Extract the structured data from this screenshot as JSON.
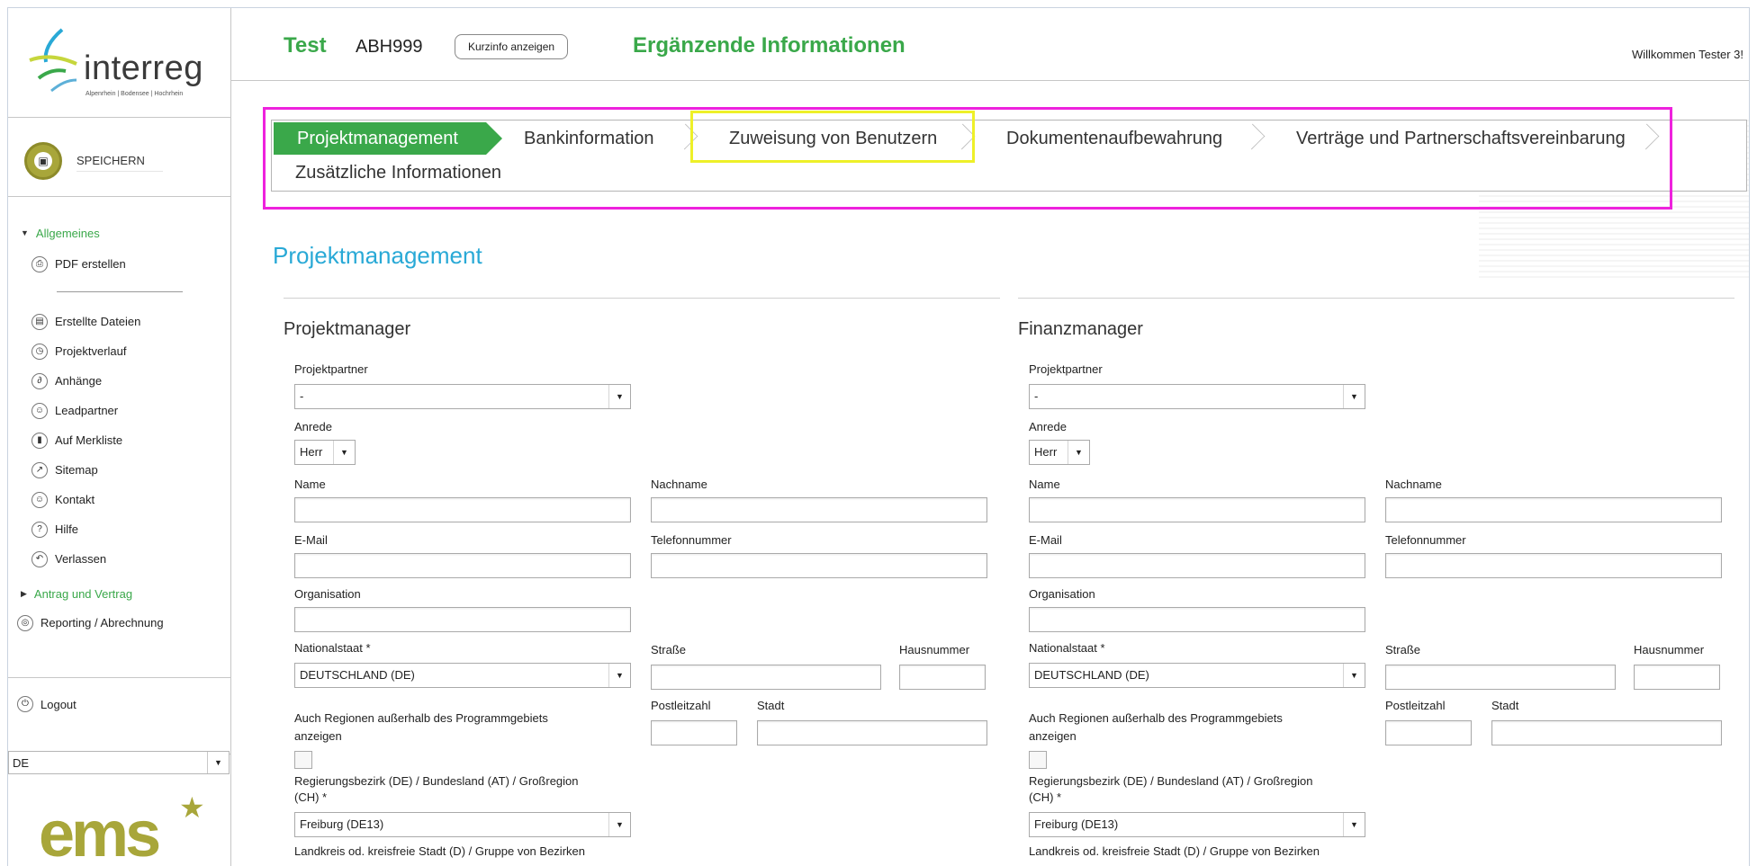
{
  "brand": {
    "logo_word": "interreg",
    "logo_subtitle": "Alpenrhein | Bodensee | Hochrhein",
    "footer_logo": "ems"
  },
  "sidebar": {
    "save_label": "SPEICHERN",
    "sections": [
      {
        "label": "Allgemeines",
        "expanded": true
      },
      {
        "label": "Antrag und Vertrag",
        "expanded": false
      }
    ],
    "items_top": [
      {
        "label": "PDF erstellen",
        "icon": "print-icon"
      }
    ],
    "items": [
      {
        "label": "Erstellte Dateien",
        "icon": "file-icon"
      },
      {
        "label": "Projektverlauf",
        "icon": "history-icon"
      },
      {
        "label": "Anhänge",
        "icon": "paperclip-icon"
      },
      {
        "label": "Leadpartner",
        "icon": "user-icon"
      },
      {
        "label": "Auf Merkliste",
        "icon": "bookmark-icon"
      },
      {
        "label": "Sitemap",
        "icon": "external-link-icon"
      },
      {
        "label": "Kontakt",
        "icon": "user-icon"
      },
      {
        "label": "Hilfe",
        "icon": "help-icon"
      },
      {
        "label": "Verlassen",
        "icon": "undo-icon"
      }
    ],
    "reporting_label": "Reporting / Abrechnung",
    "logout_label": "Logout",
    "language": "DE"
  },
  "header": {
    "title": "Test",
    "code": "ABH999",
    "info_button": "Kurzinfo anzeigen",
    "section": "Ergänzende Informationen",
    "welcome": "Willkommen Tester 3!"
  },
  "tabs": [
    {
      "label": "Projektmanagement",
      "active": true
    },
    {
      "label": "Bankinformation",
      "active": false
    },
    {
      "label": "Zuweisung von Benutzern",
      "active": false
    },
    {
      "label": "Dokumentenaufbewahrung",
      "active": false
    },
    {
      "label": "Verträge und Partnerschaftsvereinbarung",
      "active": false
    },
    {
      "label": "Zusätzliche Informationen",
      "active": false
    }
  ],
  "page_heading": "Projektmanagement",
  "columns": [
    {
      "title": "Projektmanager",
      "projektpartner_label": "Projektpartner",
      "projektpartner_value": "-",
      "anrede_label": "Anrede",
      "anrede_value": "Herr",
      "name_label": "Name",
      "nachname_label": "Nachname",
      "email_label": "E-Mail",
      "telefon_label": "Telefonnummer",
      "organisation_label": "Organisation",
      "nationalstaat_label": "Nationalstaat *",
      "nationalstaat_value": "DEUTSCHLAND (DE)",
      "strasse_label": "Straße",
      "hausnummer_label": "Hausnummer",
      "postleitzahl_label": "Postleitzahl",
      "stadt_label": "Stadt",
      "regionen_label_1": "Auch Regionen außerhalb des Programmgebiets",
      "regionen_label_2": "anzeigen",
      "region_label_1": "Regierungsbezirk (DE) / Bundesland (AT) / Großregion",
      "region_label_2": "(CH) *",
      "region_value": "Freiburg (DE13)",
      "landkreis_label": "Landkreis od. kreisfreie Stadt (D) / Gruppe von Bezirken"
    },
    {
      "title": "Finanzmanager",
      "projektpartner_label": "Projektpartner",
      "projektpartner_value": "-",
      "anrede_label": "Anrede",
      "anrede_value": "Herr",
      "name_label": "Name",
      "nachname_label": "Nachname",
      "email_label": "E-Mail",
      "telefon_label": "Telefonnummer",
      "organisation_label": "Organisation",
      "nationalstaat_label": "Nationalstaat *",
      "nationalstaat_value": "DEUTSCHLAND (DE)",
      "strasse_label": "Straße",
      "hausnummer_label": "Hausnummer",
      "postleitzahl_label": "Postleitzahl",
      "stadt_label": "Stadt",
      "regionen_label_1": "Auch Regionen außerhalb des Programmgebiets",
      "regionen_label_2": "anzeigen",
      "region_label_1": "Regierungsbezirk (DE) / Bundesland (AT) / Großregion",
      "region_label_2": "(CH) *",
      "region_value": "Freiburg (DE13)",
      "landkreis_label": "Landkreis od. kreisfreie Stadt (D) / Gruppe von Bezirken"
    }
  ],
  "colors": {
    "green": "#3aa84a",
    "heading_blue": "#29a9d6",
    "olive": "#a8a63a",
    "magenta_box": "#ee22dd",
    "yellow_box": "#eef028"
  }
}
